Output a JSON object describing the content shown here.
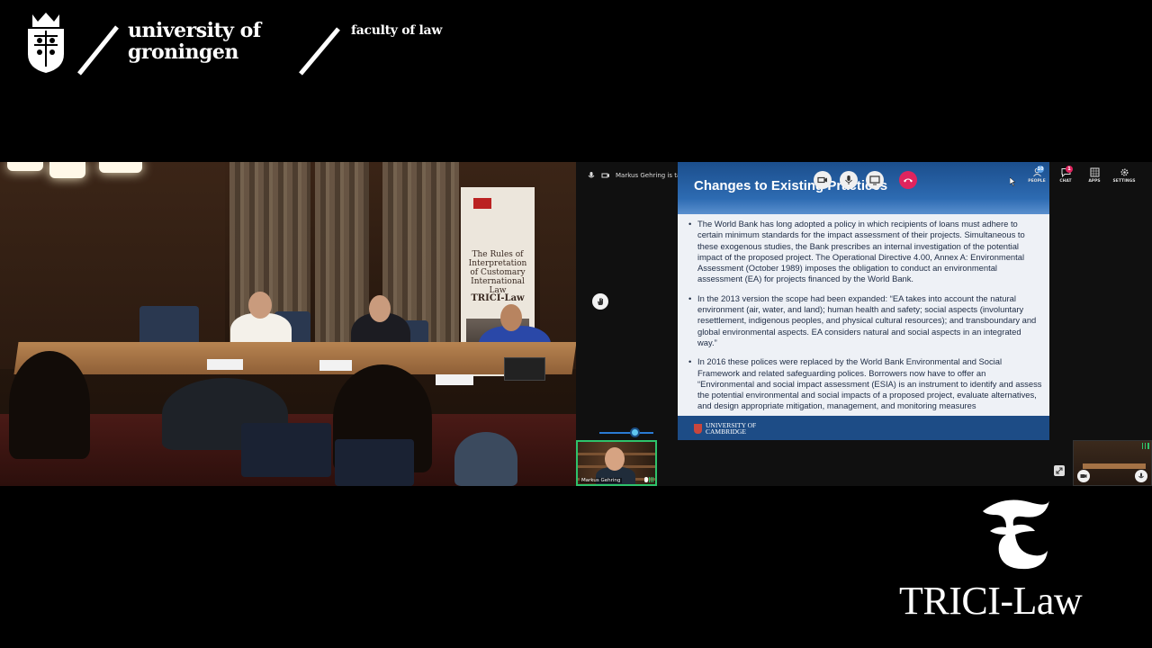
{
  "header": {
    "university_line1": "university of",
    "university_line2": "groningen",
    "faculty": "faculty of law"
  },
  "room_video": {
    "banner_text": "The Rules of Interpretation of Customary International Law",
    "banner_logo": "TRICI-Law"
  },
  "call": {
    "talking_indicator": "Markus Gehring is talking",
    "controls": [
      "camera-icon",
      "microphone-icon",
      "screen-share-icon",
      "hang-up-icon"
    ],
    "sidebar": [
      {
        "label": "PEOPLE",
        "icon": "people-icon",
        "badge": "10"
      },
      {
        "label": "CHAT",
        "icon": "chat-icon",
        "badge": "1"
      },
      {
        "label": "APPS",
        "icon": "apps-icon"
      },
      {
        "label": "SETTINGS",
        "icon": "gear-icon"
      }
    ],
    "volume_level": 0.62,
    "participant_name": "Markus Gehring",
    "colors": {
      "slide_header": "#1b4e8c",
      "hangup": "#e0245e",
      "active_speaker": "#2ec26b"
    }
  },
  "slide": {
    "title": "Changes to Existing Practices",
    "bullets": [
      "The World Bank has long adopted a policy in which recipients of loans must adhere to certain minimum standards for the impact assessment of their projects. Simultaneous to these exogenous studies, the Bank prescribes an internal investigation of the potential impact of the proposed project. The Operational Directive 4.00, Annex A: Environmental Assessment (October 1989) imposes the obligation to conduct an environmental assessment (EA) for projects financed by the World Bank.",
      "In the 2013 version the scope had been expanded: “EA takes into account the natural environment (air, water, and land); human health and safety; social aspects (involuntary resettlement, indigenous peoples, and physical cultural resources); and transboundary and global environmental aspects. EA considers natural and social aspects in an integrated way.”",
      "In 2016 these polices were replaced by the World Bank Environmental and Social Framework and related safeguarding polices. Borrowers now have to offer an “Environmental and social impact assessment (ESIA) is an instrument to identify and assess the potential environmental and social impacts of a proposed project, evaluate alternatives, and design appropriate mitigation, management, and monitoring measures"
    ],
    "footer_line1": "UNIVERSITY OF",
    "footer_line2": "CAMBRIDGE"
  },
  "footer_brand": {
    "name": "TRICI-Law"
  }
}
